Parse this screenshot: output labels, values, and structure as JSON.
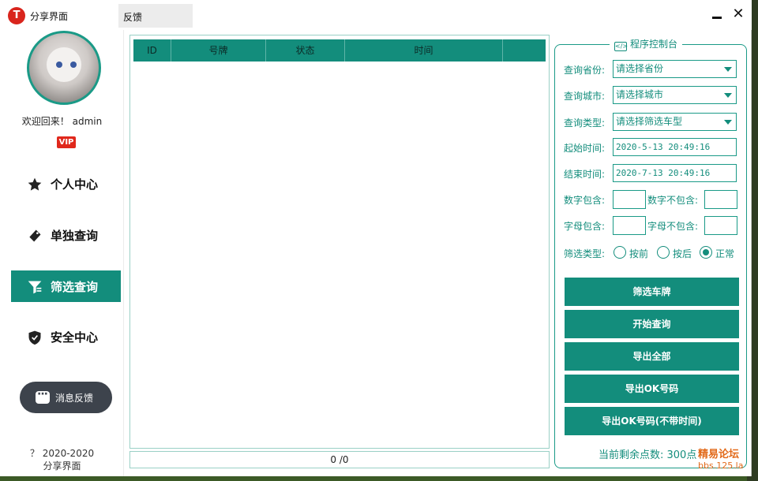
{
  "window": {
    "title": "分享界面",
    "tab_label": "反馈",
    "logo_glyph": "T"
  },
  "icons": {
    "min": "minimize-icon",
    "close": "close-icon",
    "close_glyph": "✕"
  },
  "user": {
    "welcome": "欢迎回来！ admin",
    "badge": "VIP"
  },
  "nav": [
    {
      "label": "个人中心",
      "icon": "star-icon",
      "active": false
    },
    {
      "label": "单独查询",
      "icon": "tag-icon",
      "active": false
    },
    {
      "label": "筛选查询",
      "icon": "filter-icon",
      "active": true
    },
    {
      "label": "安全中心",
      "icon": "shield-icon",
      "active": false
    }
  ],
  "feedback_button": "消息反馈",
  "copyright": {
    "line1": "？ 2020-2020",
    "line2": "分享界面"
  },
  "table": {
    "columns": [
      "ID",
      "号牌",
      "状态",
      "时间",
      ""
    ],
    "rows": []
  },
  "status_bar": "0 /0",
  "panel": {
    "title": "程序控制台",
    "province_label": "查询省份:",
    "province_value": "请选择省份",
    "city_label": "查询城市:",
    "city_value": "请选择城市",
    "type_label": "查询类型:",
    "type_value": "请选择筛选车型",
    "start_label": "起始时间:",
    "start_value": "2020-5-13 20:49:16",
    "end_label": "结束时间:",
    "end_value": "2020-7-13 20:49:16",
    "num_include_label": "数字包含:",
    "num_exclude_label": "数字不包含:",
    "letter_include_label": "字母包含:",
    "letter_exclude_label": "字母不包含:",
    "filter_type_label": "筛选类型:",
    "radios": [
      {
        "label": "按前",
        "checked": false
      },
      {
        "label": "按后",
        "checked": false
      },
      {
        "label": "正常",
        "checked": true
      }
    ],
    "buttons": [
      "筛选车牌",
      "开始查询",
      "导出全部",
      "导出OK号码",
      "导出OK号码(不带时间)"
    ],
    "points_text": "当前剩余点数: 300点"
  },
  "watermark": {
    "line1": "精易论坛",
    "line2": "bbs.125.la"
  },
  "colors": {
    "accent": "#138d7c",
    "accent_light": "#1a9a87",
    "vip": "#e0281c",
    "feedback_bg": "#3d434c"
  }
}
